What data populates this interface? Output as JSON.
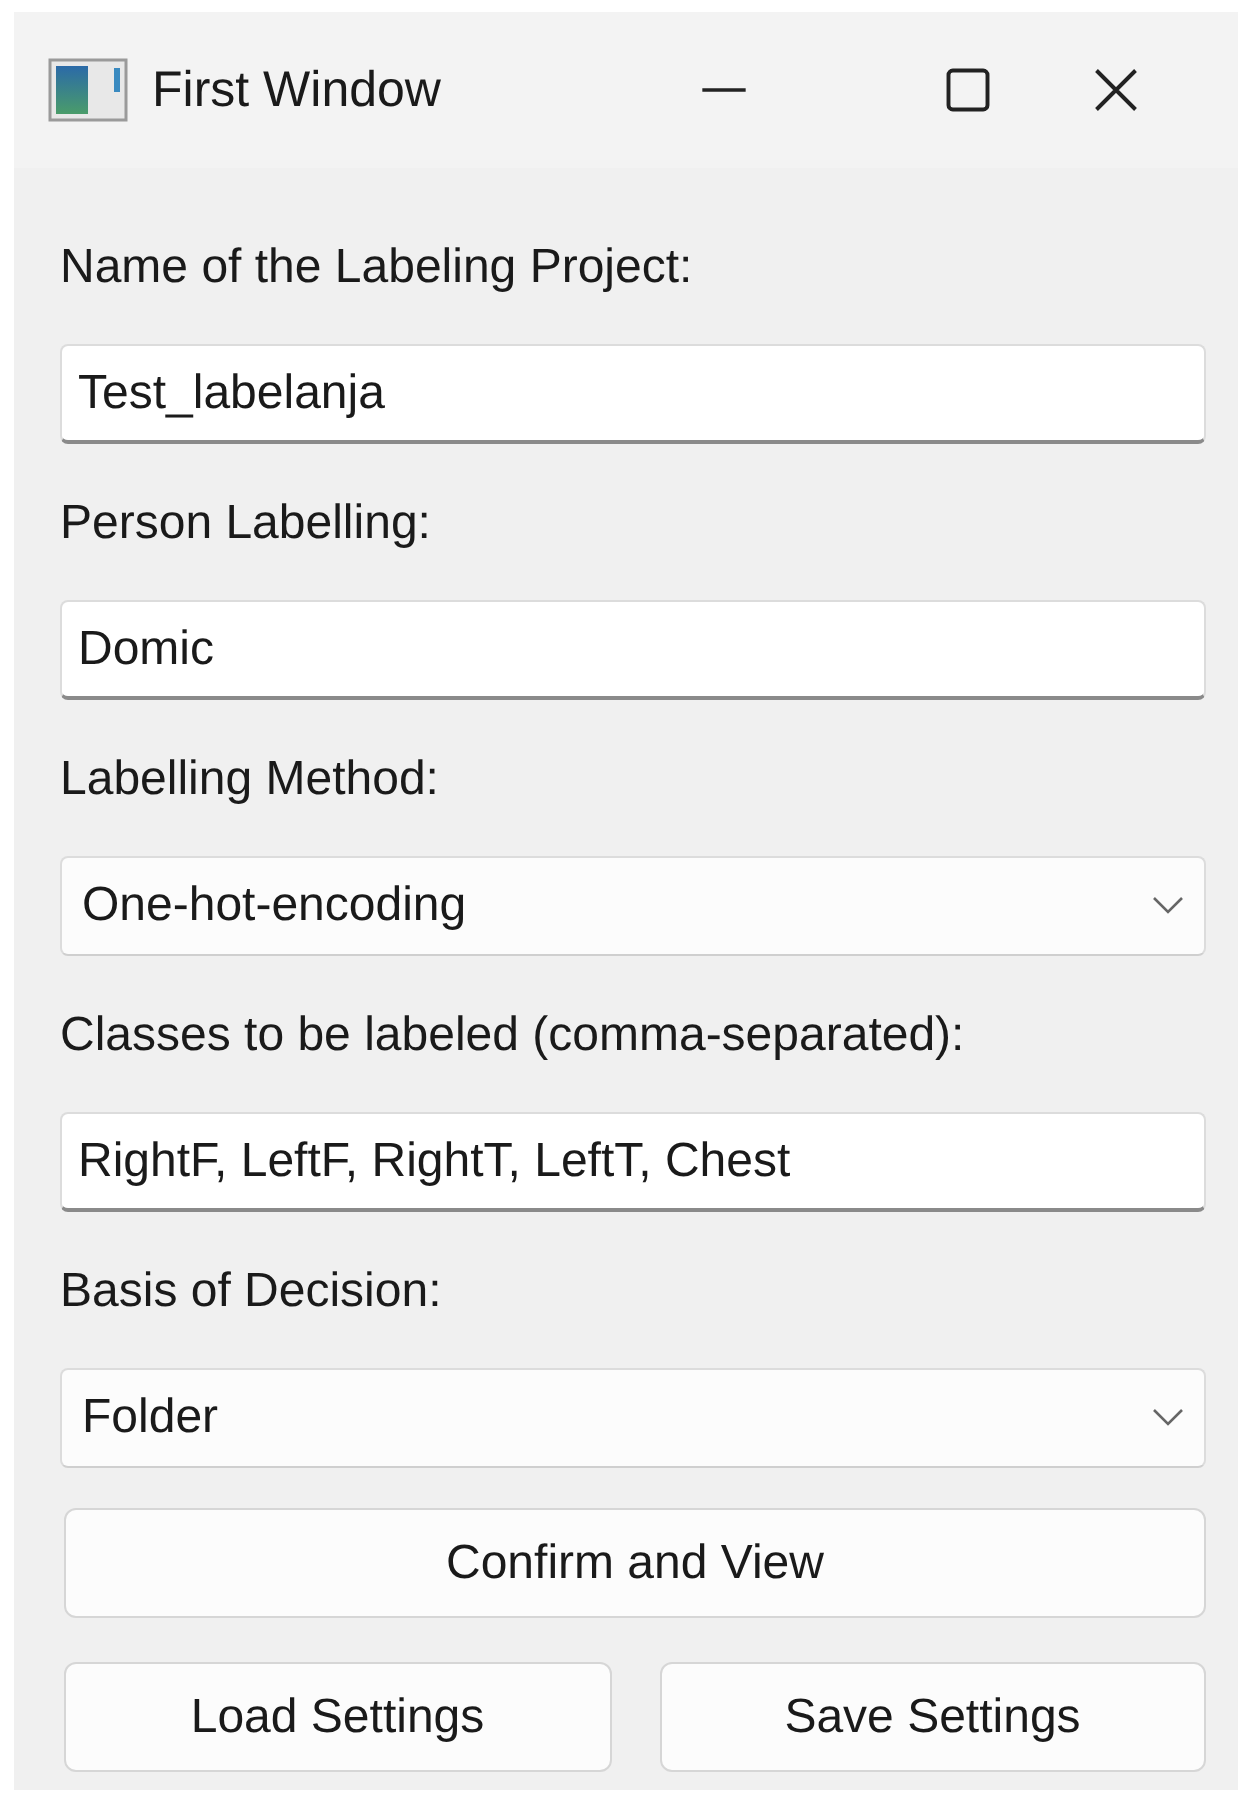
{
  "window": {
    "title": "First Window"
  },
  "fields": [
    {
      "label": "Name of the Labeling Project:",
      "kind": "text",
      "value": "Test_labelanja"
    },
    {
      "label": "Person Labelling:",
      "kind": "text",
      "value": "Domic"
    },
    {
      "label": "Labelling Method:",
      "kind": "combo",
      "value": "One-hot-encoding"
    },
    {
      "label": "Classes to be labeled (comma-separated):",
      "kind": "text",
      "value": "RightF, LeftF, RightT, LeftT, Chest"
    },
    {
      "label": "Basis of Decision:",
      "kind": "combo",
      "value": "Folder"
    }
  ],
  "button_rows": [
    [
      "Confirm and View"
    ],
    [
      "Load Settings",
      "Save Settings"
    ]
  ]
}
